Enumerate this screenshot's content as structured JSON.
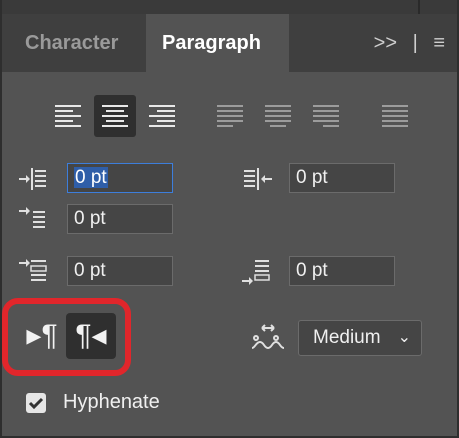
{
  "tabs": [
    {
      "label": "Character",
      "active": false
    },
    {
      "label": "Paragraph",
      "active": true
    }
  ],
  "tab_tools": {
    "expand": ">>",
    "divider": "|",
    "menu": "≡"
  },
  "alignment_buttons": [
    {
      "name": "align-left-icon",
      "selected": false
    },
    {
      "name": "align-center-icon",
      "selected": true
    },
    {
      "name": "align-right-icon",
      "selected": false
    },
    {
      "name": "justify-last-left-icon",
      "selected": false
    },
    {
      "name": "justify-last-center-icon",
      "selected": false
    },
    {
      "name": "justify-last-right-icon",
      "selected": false
    },
    {
      "name": "justify-all-icon",
      "selected": false
    }
  ],
  "fields": {
    "indent_left": {
      "value": "0 pt",
      "focused": true
    },
    "indent_right": {
      "value": "0 pt"
    },
    "indent_first_line": {
      "value": "0 pt"
    },
    "space_before": {
      "value": "0 pt"
    },
    "space_after": {
      "value": "0 pt"
    }
  },
  "direction": {
    "ltr_symbol": "▸¶",
    "rtl_symbol": "¶◂",
    "selected": "rtl"
  },
  "kashida": {
    "icon": "kashida-icon",
    "value": "Medium",
    "chevron": "⌄"
  },
  "hyphenate": {
    "label": "Hyphenate",
    "checked": true
  },
  "colors": {
    "highlight": "#e1262b",
    "focus": "#3d7edb"
  }
}
